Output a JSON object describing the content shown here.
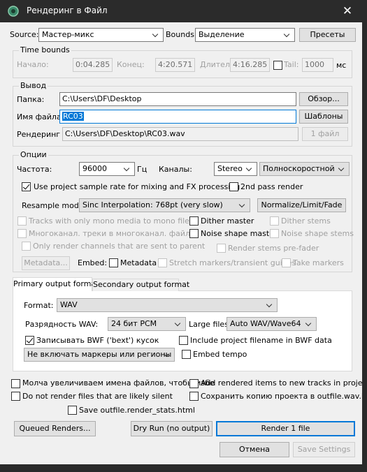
{
  "window": {
    "title": "Рендеринг в Файл",
    "close_glyph": "✕",
    "app_icon": "reaper-icon"
  },
  "top": {
    "source_label": "Source:",
    "source_value": "Мастер-микс",
    "bounds_label": "Bounds:",
    "bounds_value": "Выделение",
    "presets_label": "Пресеты"
  },
  "time_bounds": {
    "title": "Time bounds",
    "start_label": "Начало:",
    "start_value": "0:04.285",
    "end_label": "Конец:",
    "end_value": "4:20.571",
    "length_label": "Длител",
    "length_value": "4:16.285",
    "tail_label": "Tail:",
    "tail_value": "1000",
    "tail_unit": "мс"
  },
  "output": {
    "title": "Вывод",
    "folder_label": "Папка:",
    "folder_value": "C:\\Users\\DF\\Desktop",
    "browse_label": "Обзор...",
    "filename_label": "Имя файла:",
    "filename_value": "RC03",
    "wildcards_label": "Шаблоны",
    "render_to_label": "Рендеринг",
    "render_to_value": "C:\\Users\\DF\\Desktop\\RC03.wav",
    "files_count_label": "1 файл"
  },
  "options": {
    "title": "Опции",
    "rate_label": "Частота:",
    "rate_value": "96000",
    "rate_unit": "Гц",
    "channels_label": "Каналы:",
    "channels_value": "Stereo",
    "speed_value": "Полноскоростной",
    "use_project_rate": "Use project sample rate for mixing and FX processing",
    "second_pass": "2nd pass render",
    "resample_label": "Resample mode:",
    "resample_value": "Sinc Interpolation: 768pt (very slow)",
    "normalize_label": "Normalize/Limit/Fade",
    "mono_tracks": "Tracks with only mono media to mono files",
    "dither_master": "Dither master",
    "dither_stems": "Dither stems",
    "multichannel": "Многоканал. треки в многоканал. файлы",
    "noise_master": "Noise shape master",
    "noise_stems": "Noise shape stems",
    "only_parent": "Only render channels that are sent to parent",
    "stems_prefader": "Render stems pre-fader",
    "metadata_button": "Metadata...",
    "embed_label": "Embed:",
    "embed_metadata": "Metadata",
    "embed_stretch": "Stretch markers/transient guides",
    "embed_take": "Take markers"
  },
  "format": {
    "tab_primary": "Primary output format",
    "tab_secondary": "Secondary output format",
    "format_label": "Format:",
    "format_value": "WAV",
    "bitdepth_label": "Разрядность WAV:",
    "bitdepth_value": "24 бит PCM",
    "large_files_label": "Large files:",
    "large_files_value": "Auto WAV/Wave64",
    "write_bwf": "Записывать BWF ('bext') кусок",
    "include_filename_bwf": "Include project filename in BWF data",
    "markers_value": "Не включать маркеры или регионы",
    "embed_tempo": "Embed tempo"
  },
  "bottom": {
    "silently_increment": "Молча увеличиваем имена файлов, чтобы избе",
    "add_to_tracks": "Add rendered items to new tracks in project",
    "skip_silent": "Do not render files that are likely silent",
    "save_project_copy": "Сохранить копию проекта в outfile.wav.RPP",
    "save_stats": "Save outfile.render_stats.html",
    "queued_label": "Queued Renders...",
    "dryrun_label": "Dry Run (no output)",
    "render_label": "Render 1 file",
    "cancel_label": "Отмена",
    "save_settings_label": "Save Settings"
  },
  "colors": {
    "accent": "#0078d7",
    "titlebar": "#2b2b2b",
    "dialog_bg": "#f0f0f0"
  }
}
